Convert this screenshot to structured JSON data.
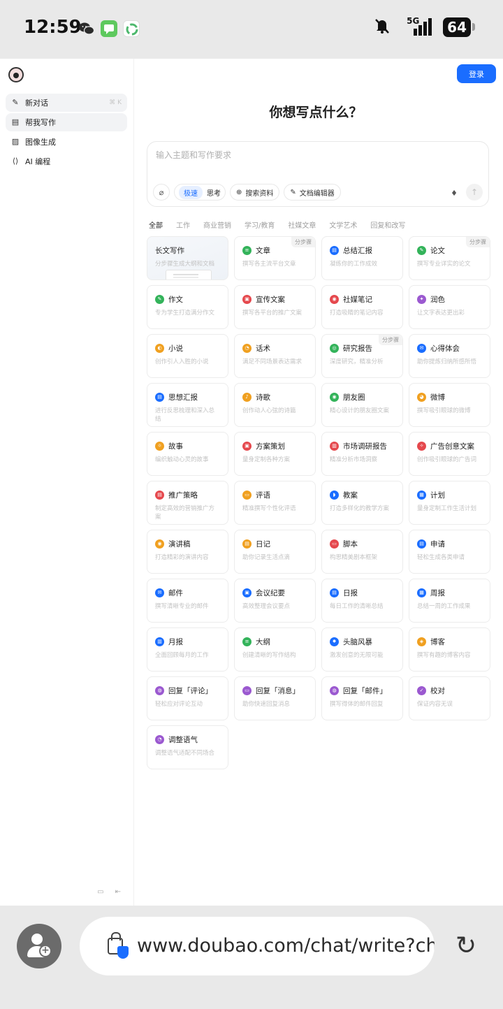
{
  "status": {
    "time": "12:59",
    "apps": [
      {
        "icon": "wechat-icon",
        "color": "#2b2b2b"
      },
      {
        "icon": "messages-icon",
        "color": "#5ec95e"
      },
      {
        "icon": "recycle-app-icon",
        "color": "#4db86d"
      }
    ],
    "network": "5G",
    "battery": "64"
  },
  "sidebar": {
    "items": [
      {
        "label": "新对话",
        "shortcut": "⌘ K",
        "icon": "edit-icon"
      },
      {
        "label": "帮我写作",
        "icon": "write-icon"
      },
      {
        "label": "图像生成",
        "icon": "image-icon"
      },
      {
        "label": "AI 编程",
        "icon": "code-icon"
      }
    ]
  },
  "main": {
    "login": "登录",
    "title": "你想写点什么？",
    "composer": {
      "placeholder": "输入主题和写作要求",
      "mode_fast": "极速",
      "mode_think": "思考",
      "search": "搜索资料",
      "editor": "文档编辑器"
    },
    "tabs": [
      "全部",
      "工作",
      "商业营销",
      "学习/教育",
      "社媒文章",
      "文学艺术",
      "回复和改写"
    ],
    "cards": [
      {
        "name": "长文写作",
        "desc": "分步骤生成大纲和文档",
        "hero": true
      },
      {
        "name": "文章",
        "desc": "撰写各主流平台文章",
        "color": "#33b35a",
        "glyph": "≡",
        "badge": "分步骤"
      },
      {
        "name": "总结汇报",
        "desc": "凝练你的工作成效",
        "color": "#1a6dff",
        "glyph": "▤"
      },
      {
        "name": "论文",
        "desc": "撰写专业详实的论文",
        "color": "#33b35a",
        "glyph": "✎",
        "badge": "分步骤"
      },
      {
        "name": "作文",
        "desc": "专为学生打造满分作文",
        "color": "#33b35a",
        "glyph": "✎"
      },
      {
        "name": "宣传文案",
        "desc": "撰写各平台的推广文案",
        "color": "#e5484d",
        "glyph": "▣"
      },
      {
        "name": "社媒笔记",
        "desc": "打造吸睛的笔记内容",
        "color": "#e5484d",
        "glyph": "◉"
      },
      {
        "name": "润色",
        "desc": "让文字表达更出彩",
        "color": "#9b59d0",
        "glyph": "✦"
      },
      {
        "name": "小说",
        "desc": "创作引人入胜的小说",
        "color": "#f0a020",
        "glyph": "◐"
      },
      {
        "name": "话术",
        "desc": "满足不同场景表达需求",
        "color": "#f0a020",
        "glyph": "◔"
      },
      {
        "name": "研究报告",
        "desc": "深度研究，精准分析",
        "color": "#33b35a",
        "glyph": "◎",
        "badge": "分步骤"
      },
      {
        "name": "心得体会",
        "desc": "助你提炼归纳所感所悟",
        "color": "#1a6dff",
        "glyph": "✉"
      },
      {
        "name": "思想汇报",
        "desc": "进行反思梳理和深入总结",
        "color": "#1a6dff",
        "glyph": "▤"
      },
      {
        "name": "诗歌",
        "desc": "创作动人心弦的诗篇",
        "color": "#f0a020",
        "glyph": "♪"
      },
      {
        "name": "朋友圈",
        "desc": "精心设计的朋友圈文案",
        "color": "#33b35a",
        "glyph": "◉"
      },
      {
        "name": "微博",
        "desc": "撰写吸引眼球的微博",
        "color": "#f0a020",
        "glyph": "◕"
      },
      {
        "name": "故事",
        "desc": "编织触动心灵的故事",
        "color": "#f0a020",
        "glyph": "☼"
      },
      {
        "name": "方案策划",
        "desc": "量身定制各种方案",
        "color": "#e5484d",
        "glyph": "▣"
      },
      {
        "name": "市场调研报告",
        "desc": "精准分析市场洞察",
        "color": "#e5484d",
        "glyph": "▥"
      },
      {
        "name": "广告创意文案",
        "desc": "创作吸引眼球的广告词",
        "color": "#e5484d",
        "glyph": "✧"
      },
      {
        "name": "推广策略",
        "desc": "制定高效的营销推广方案",
        "color": "#e5484d",
        "glyph": "▤"
      },
      {
        "name": "评语",
        "desc": "精准撰写个性化评语",
        "color": "#f0a020",
        "glyph": "▭"
      },
      {
        "name": "教案",
        "desc": "打造多样化的教学方案",
        "color": "#1a6dff",
        "glyph": "◗"
      },
      {
        "name": "计划",
        "desc": "量身定制工作生活计划",
        "color": "#1a6dff",
        "glyph": "▦"
      },
      {
        "name": "演讲稿",
        "desc": "打造精彩的演讲内容",
        "color": "#f0a020",
        "glyph": "◉"
      },
      {
        "name": "日记",
        "desc": "助你记录生活点滴",
        "color": "#f0a020",
        "glyph": "▤"
      },
      {
        "name": "脚本",
        "desc": "构思精美剧本框架",
        "color": "#e5484d",
        "glyph": "▭"
      },
      {
        "name": "申请",
        "desc": "轻松生成各类申请",
        "color": "#1a6dff",
        "glyph": "▤"
      },
      {
        "name": "邮件",
        "desc": "撰写清晰专业的邮件",
        "color": "#1a6dff",
        "glyph": "✉"
      },
      {
        "name": "会议纪要",
        "desc": "高效整理会议要点",
        "color": "#1a6dff",
        "glyph": "▣"
      },
      {
        "name": "日报",
        "desc": "每日工作的清晰总结",
        "color": "#1a6dff",
        "glyph": "▤"
      },
      {
        "name": "周报",
        "desc": "总结一周的工作成果",
        "color": "#1a6dff",
        "glyph": "▦"
      },
      {
        "name": "月报",
        "desc": "全面回顾每月的工作",
        "color": "#1a6dff",
        "glyph": "▥"
      },
      {
        "name": "大纲",
        "desc": "创建清晰的写作结构",
        "color": "#33b35a",
        "glyph": "≡"
      },
      {
        "name": "头脑风暴",
        "desc": "激发创意的无限可能",
        "color": "#1a6dff",
        "glyph": "✸"
      },
      {
        "name": "博客",
        "desc": "撰写有趣的博客内容",
        "color": "#f0a020",
        "glyph": "◈"
      },
      {
        "name": "回复「评论」",
        "desc": "轻松应对评论互动",
        "color": "#9b59d0",
        "glyph": "◍"
      },
      {
        "name": "回复「消息」",
        "desc": "助你快速回复消息",
        "color": "#9b59d0",
        "glyph": "▭"
      },
      {
        "name": "回复「邮件」",
        "desc": "撰写得体的邮件回复",
        "color": "#9b59d0",
        "glyph": "◍"
      },
      {
        "name": "校对",
        "desc": "保证内容无误",
        "color": "#9b59d0",
        "glyph": "✓"
      },
      {
        "name": "调整语气",
        "desc": "调整语气适配不同场合",
        "color": "#9b59d0",
        "glyph": "◔"
      }
    ]
  },
  "browser": {
    "url": "www.doubao.com/chat/write?ch"
  }
}
